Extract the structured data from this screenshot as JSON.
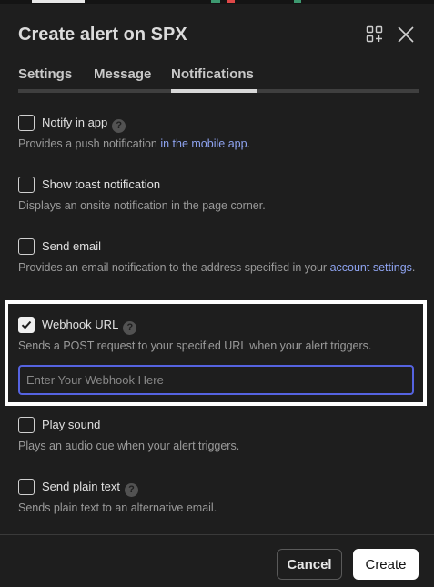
{
  "dialog": {
    "title": "Create alert on SPX"
  },
  "tabs": [
    {
      "label": "Settings",
      "active": false
    },
    {
      "label": "Message",
      "active": false
    },
    {
      "label": "Notifications",
      "active": true
    }
  ],
  "options": [
    {
      "label": "Notify in app",
      "checked": false,
      "help": "?",
      "desc": "Provides a push notification ",
      "link": "in the mobile app",
      "desc_after": "."
    },
    {
      "label": "Show toast notification",
      "checked": false,
      "desc": "Displays an onsite notification in the page corner."
    },
    {
      "label": "Send email",
      "checked": false,
      "desc": "Provides an email notification to the address specified in your ",
      "link": "account settings",
      "desc_after": "."
    },
    {
      "label": "Webhook URL",
      "checked": true,
      "help": "?",
      "desc": "Sends a POST request to your specified URL when your alert triggers."
    },
    {
      "label": "Play sound",
      "checked": false,
      "desc": "Plays an audio cue when your alert triggers."
    },
    {
      "label": "Send plain text",
      "checked": false,
      "help": "?",
      "desc": "Sends plain text to an alternative email."
    }
  ],
  "webhook": {
    "placeholder": "Enter Your Webhook Here",
    "value": ""
  },
  "buttons": {
    "cancel": "Cancel",
    "create": "Create"
  },
  "icons": {
    "add_widget": "add-widget-icon",
    "close": "close-icon",
    "check": "check-icon"
  },
  "colors": {
    "background": "#1e1e1e",
    "link": "#8ea3f0",
    "focus_border": "#5563e0",
    "highlight_box": "#ffffff"
  }
}
